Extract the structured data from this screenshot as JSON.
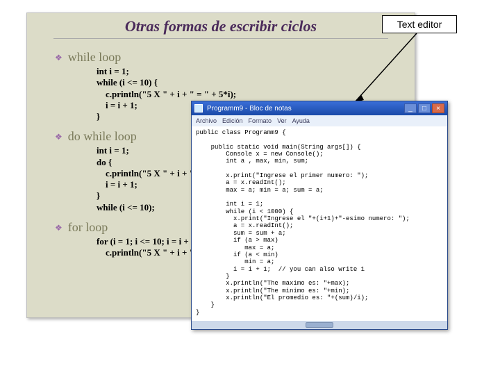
{
  "label": "Text editor",
  "slide": {
    "title": "Otras formas de escribir ciclos",
    "loops": [
      {
        "name": "while loop",
        "code": "int i = 1;\nwhile (i <= 10) {\n    c.println(\"5 X \" + i + \" = \" + 5*i);\n    i = i + 1;\n}"
      },
      {
        "name": "do while loop",
        "code": "int i = 1;\ndo {\n    c.println(\"5 X \" + i + \" = \" + 5*i);\n    i = i + 1;\n}\nwhile (i <= 10);"
      },
      {
        "name": "for loop",
        "code": "for (i = 1; i <= 10; i = i + 1)\n    c.println(\"5 X \" + i + \" = \" + 5*i);"
      }
    ]
  },
  "notepad": {
    "title": "Programm9 - Bloc de notas",
    "menus": [
      "Archivo",
      "Edición",
      "Formato",
      "Ver",
      "Ayuda"
    ],
    "winbtns": {
      "min": "_",
      "max": "□",
      "close": "×"
    },
    "code": "public class Programm9 {\n\n    public static void main(String args[]) {\n        Console x = new Console();\n        int a , max, min, sum;\n\n        x.print(\"Ingrese el primer numero: \");\n        a = x.readInt();\n        max = a; min = a; sum = a;\n\n        int i = 1;\n        while (i < 1000) {\n          x.print(\"Ingrese el \"+(i+1)+\"-esimo numero: \");\n          a = x.readInt();\n          sum = sum + a;\n          if (a > max)\n             max = a;\n          if (a < min)\n             min = a;\n          i = i + 1;  // you can also write 1\n        }\n        x.println(\"The maximo es: \"+max);\n        x.println(\"The minimo es: \"+min);\n        x.println(\"El promedio es: \"+(sum)/i);\n    }\n}"
  }
}
